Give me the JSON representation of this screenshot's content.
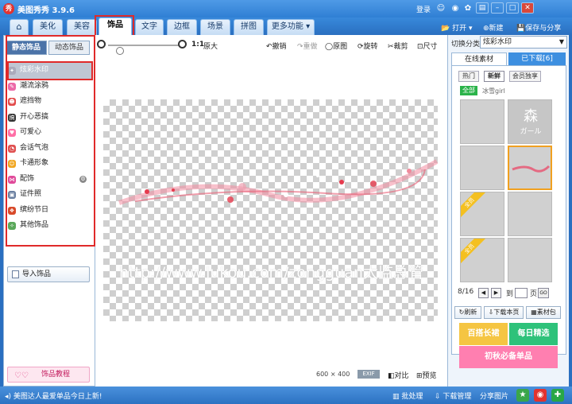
{
  "app": {
    "title": "美图秀秀 3.9.6",
    "login": "登录"
  },
  "tabs": [
    "美化",
    "美容",
    "饰品",
    "文字",
    "边框",
    "场景",
    "拼图",
    "更多功能"
  ],
  "right_tools": {
    "open": "打开",
    "new": "新建",
    "save_share": "保存与分享"
  },
  "left": {
    "subtabs": [
      "静态饰品",
      "动态饰品"
    ],
    "categories": [
      "炫彩水印",
      "潮流涂鸦",
      "遮挡物",
      "开心恶搞",
      "可爱心",
      "会话气泡",
      "卡通形象",
      "配饰",
      "证件照",
      "缤纷节日",
      "其他饰品"
    ],
    "import_label": "导入饰品",
    "tutorial_label": "饰品教程"
  },
  "toolbar": {
    "zoom_ratio": "1:1",
    "original": "原大",
    "undo": "撤销",
    "redo": "重做",
    "original_image": "原图",
    "rotate": "旋转",
    "crop": "裁剪",
    "size": "尺寸"
  },
  "canvas": {
    "watermark": "http://www.lukou.com/zongguan太监总管"
  },
  "bottom": {
    "size_w": "600",
    "size_x": "×",
    "size_h": "400",
    "exif": "EXIF",
    "compare": "对比",
    "preview": "预览"
  },
  "right": {
    "switch_label": "切换分类",
    "switch_value": "炫彩水印",
    "tab_online": "在线素材",
    "tab_downloaded": "已下载[6]",
    "pills": [
      "热门",
      "新鲜",
      "会员独享"
    ],
    "all_tag": "全部",
    "tag_text": "冰雪girl",
    "thumb_text_1": "森",
    "thumb_text_2": "ガール",
    "ribbon": "全员",
    "page": "8/16",
    "page_to": "到",
    "page_unit": "页",
    "go": "GO",
    "refresh": "刷新",
    "download_page": "下载本页",
    "material_pack": "素材包",
    "banner_1": "百搭长裙",
    "banner_2": "每日精选",
    "banner_3": "初秋必备单品"
  },
  "status": {
    "message": "美图达人最爱单品今日上新!",
    "batch": "批处理",
    "download_mgr": "下载管理",
    "share": "分享图片"
  }
}
